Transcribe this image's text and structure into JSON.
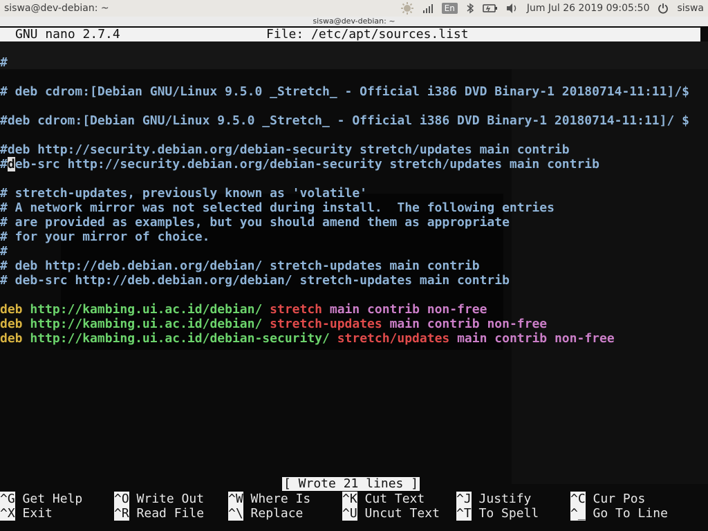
{
  "panel": {
    "title": "siswa@dev-debian: ~",
    "lang": "En",
    "datetime": "Jum Jul 26 2019 09:05:50",
    "user": "siswa",
    "icons": [
      "weather-icon",
      "signal-icon",
      "bluetooth-icon",
      "battery-icon",
      "volume-icon",
      "power-icon"
    ]
  },
  "window": {
    "title": "siswa@dev-debian: ~"
  },
  "nano": {
    "program": "GNU nano 2.7.4",
    "file_label": "File: /etc/apt/sources.list",
    "status": "[ Wrote 21 lines ]"
  },
  "lines": {
    "l1": "#",
    "l2": "# deb cdrom:[Debian GNU/Linux 9.5.0 _Stretch_ - Official i386 DVD Binary-1 20180714-11:11]/$",
    "l3": "#deb cdrom:[Debian GNU/Linux 9.5.0 _Stretch_ - Official i386 DVD Binary-1 20180714-11:11]/ $",
    "l4": "#deb http://security.debian.org/debian-security stretch/updates main contrib",
    "l5_hash": "#",
    "l5_cursor": "d",
    "l5_rest": "eb-src http://security.debian.org/debian-security stretch/updates main contrib",
    "l6": "# stretch-updates, previously known as 'volatile'",
    "l7": "# A network mirror was not selected during install.  The following entries",
    "l8": "# are provided as examples, but you should amend them as appropriate",
    "l9": "# for your mirror of choice.",
    "l10": "#",
    "l11": "# deb http://deb.debian.org/debian/ stretch-updates main contrib",
    "l12": "# deb-src http://deb.debian.org/debian/ stretch-updates main contrib",
    "deb1": {
      "kw": "deb",
      "url": "http://kambing.ui.ac.id/debian/",
      "suite": "stretch",
      "comp": "main contrib non-free"
    },
    "deb2": {
      "kw": "deb",
      "url": "http://kambing.ui.ac.id/debian/",
      "suite": "stretch-updates",
      "comp": "main contrib non-free"
    },
    "deb3": {
      "kw": "deb",
      "url": "http://kambing.ui.ac.id/debian-security/",
      "suite": "stretch/updates",
      "comp": "main contrib non-free"
    }
  },
  "shortcuts": [
    {
      "key": "^G",
      "label": "Get Help"
    },
    {
      "key": "^O",
      "label": "Write Out"
    },
    {
      "key": "^W",
      "label": "Where Is"
    },
    {
      "key": "^K",
      "label": "Cut Text"
    },
    {
      "key": "^J",
      "label": "Justify"
    },
    {
      "key": "^C",
      "label": "Cur Pos"
    },
    {
      "key": "^X",
      "label": "Exit"
    },
    {
      "key": "^R",
      "label": "Read File"
    },
    {
      "key": "^\\",
      "label": "Replace"
    },
    {
      "key": "^U",
      "label": "Uncut Text"
    },
    {
      "key": "^T",
      "label": "To Spell"
    },
    {
      "key": "^_",
      "label": "Go To Line"
    }
  ],
  "colors": {
    "comment": "#8fb4d8",
    "keyword": "#d9b441",
    "url": "#6cd46c",
    "suite": "#e14b4b",
    "component": "#cc7fc9"
  }
}
